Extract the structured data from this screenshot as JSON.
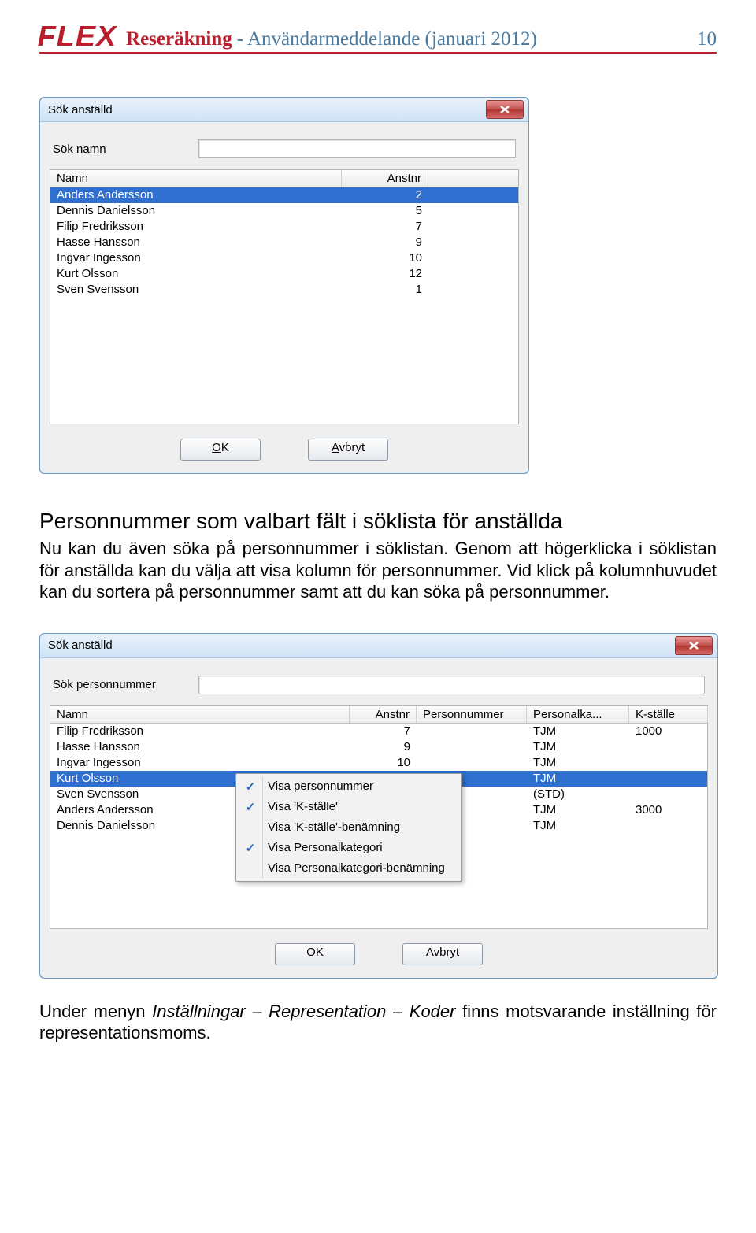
{
  "header": {
    "logo": "FLEX",
    "title": "Reseräkning",
    "subtitle": " - Användarmeddelande (januari 2012)",
    "page": "10"
  },
  "dialog1": {
    "title": "Sök anställd",
    "searchLabel": "Sök namn",
    "columns": {
      "name": "Namn",
      "anstnr": "Anstnr"
    },
    "rows": [
      {
        "name": "Anders Andersson",
        "anstnr": "2",
        "selected": true
      },
      {
        "name": "Dennis Danielsson",
        "anstnr": "5"
      },
      {
        "name": "Filip Fredriksson",
        "anstnr": "7"
      },
      {
        "name": "Hasse Hansson",
        "anstnr": "9"
      },
      {
        "name": "Ingvar Ingesson",
        "anstnr": "10"
      },
      {
        "name": "Kurt Olsson",
        "anstnr": "12"
      },
      {
        "name": "Sven Svensson",
        "anstnr": "1"
      }
    ],
    "ok": "OK",
    "cancel": "Avbryt"
  },
  "section": {
    "heading": "Personnummer som valbart fält i söklista för anställda",
    "body": "Nu kan du även söka på personnummer i söklistan. Genom att högerklicka i söklistan för anställda kan du välja att visa kolumn för personnummer. Vid klick på kolumnhuvudet kan du sortera på personnummer samt att du kan söka på personnummer."
  },
  "dialog2": {
    "title": "Sök anställd",
    "searchLabel": "Sök personnummer",
    "columns": {
      "name": "Namn",
      "anstnr": "Anstnr",
      "pnr": "Personnummer",
      "pkat": "Personalka...",
      "kst": "K-ställe"
    },
    "rows": [
      {
        "name": "Filip Fredriksson",
        "anstnr": "7",
        "pkat": "TJM",
        "kst": "1000"
      },
      {
        "name": "Hasse Hansson",
        "anstnr": "9",
        "pkat": "TJM",
        "kst": ""
      },
      {
        "name": "Ingvar Ingesson",
        "anstnr": "10",
        "pkat": "TJM",
        "kst": ""
      },
      {
        "name": "Kurt Olsson",
        "anstnr": "",
        "pkat": "TJM",
        "kst": "",
        "selected": true
      },
      {
        "name": "Sven Svensson",
        "anstnr": "",
        "pkat": "(STD)",
        "kst": ""
      },
      {
        "name": "Anders Andersson",
        "anstnr": "",
        "pkat": "TJM",
        "kst": "3000"
      },
      {
        "name": "Dennis Danielsson",
        "anstnr": "",
        "pkat": "TJM",
        "kst": ""
      }
    ],
    "menu": [
      {
        "label": "Visa personnummer",
        "checked": true
      },
      {
        "label": "Visa 'K-ställe'",
        "checked": true
      },
      {
        "label": "Visa 'K-ställe'-benämning",
        "checked": false
      },
      {
        "label": "Visa Personalkategori",
        "checked": true
      },
      {
        "label": "Visa Personalkategori-benämning",
        "checked": false
      }
    ],
    "ok": "OK",
    "cancel": "Avbryt"
  },
  "footer": {
    "text_pre": "Under menyn ",
    "text_em": "Inställningar – Representation – Koder",
    "text_post": " finns motsvarande inställning för representationsmoms."
  }
}
